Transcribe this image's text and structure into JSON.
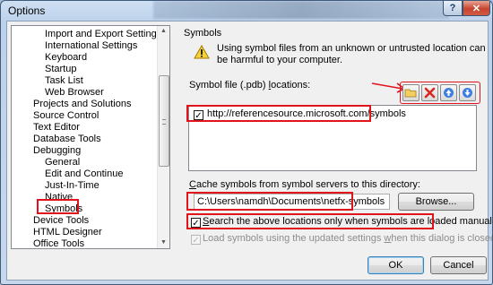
{
  "window": {
    "title": "Options",
    "help_label": "?",
    "close_label": "✕"
  },
  "tree": {
    "items": [
      {
        "label": "Import and Export Settings"
      },
      {
        "label": "International Settings"
      },
      {
        "label": "Keyboard"
      },
      {
        "label": "Startup"
      },
      {
        "label": "Task List"
      },
      {
        "label": "Web Browser"
      },
      {
        "label": "Projects and Solutions"
      },
      {
        "label": "Source Control"
      },
      {
        "label": "Text Editor"
      },
      {
        "label": "Database Tools"
      },
      {
        "label": "Debugging"
      },
      {
        "label": "General"
      },
      {
        "label": "Edit and Continue"
      },
      {
        "label": "Just-In-Time"
      },
      {
        "label": "Native"
      },
      {
        "label": "Symbols"
      },
      {
        "label": "Device Tools"
      },
      {
        "label": "HTML Designer"
      },
      {
        "label": "Office Tools"
      }
    ],
    "selected": "Symbols"
  },
  "symbols": {
    "section_title": "Symbols",
    "warning": "Using symbol files from an unknown or untrusted location can be harmful to your computer.",
    "locations_label_prefix": "Symbol file (.pdb) ",
    "locations_label_access": "l",
    "locations_label_suffix": "ocations:",
    "location_entry": "http://referencesource.microsoft.com/symbols",
    "location_checked": true,
    "cache_label_access": "C",
    "cache_label_suffix": "ache symbols from symbol servers to this directory:",
    "cache_path": "C:\\Users\\namdh\\Documents\\netfx-symbols",
    "browse_label": "Browse...",
    "search_only_access": "S",
    "search_only_suffix": "earch the above locations only when symbols are loaded manually",
    "search_only_checked": true,
    "load_prefix": "Load symbols using the updated settings ",
    "load_access": "w",
    "load_suffix": "hen this dialog is closed",
    "load_checked": true,
    "load_enabled": false
  },
  "toolbar": {
    "folder_icon": "folder-icon",
    "remove_icon": "red-x-icon",
    "up_icon": "move-up-icon",
    "down_icon": "move-down-icon"
  },
  "footer": {
    "ok_label": "OK",
    "cancel_label": "Cancel"
  },
  "annotation_color": "#e2141b"
}
